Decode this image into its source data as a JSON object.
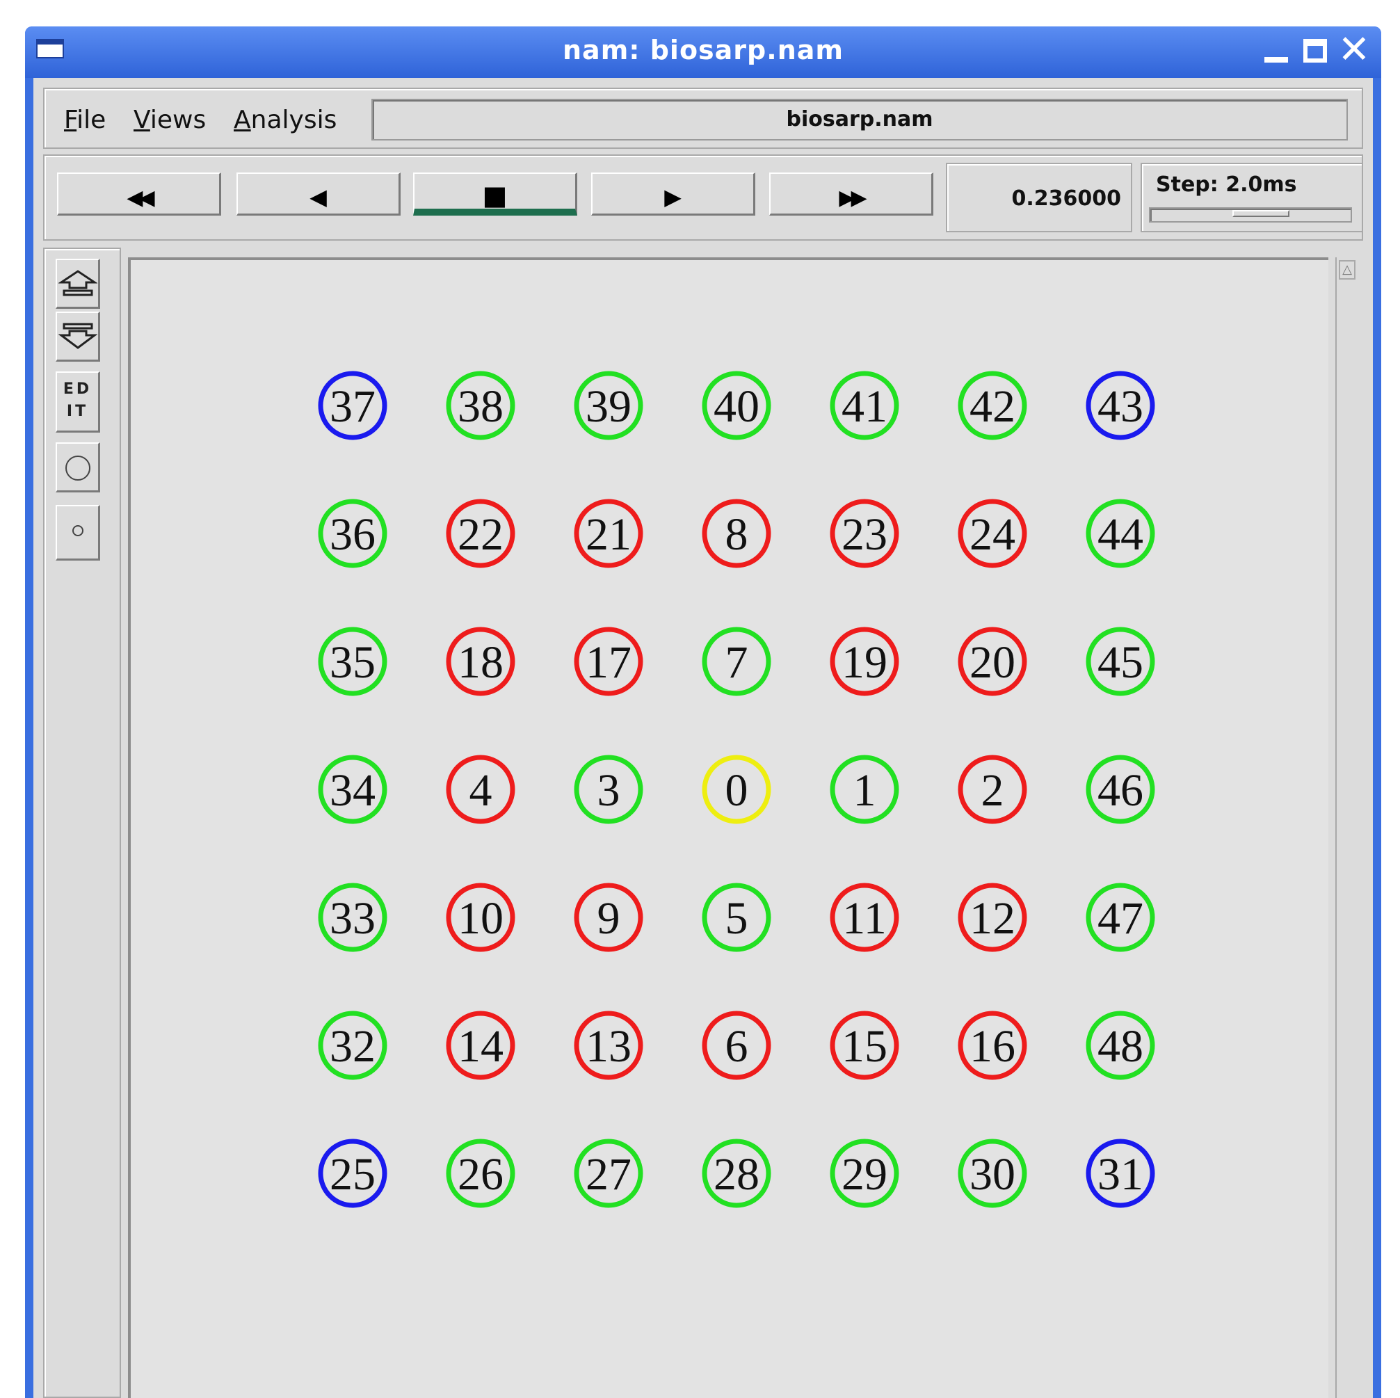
{
  "window": {
    "title": "nam: biosarp.nam",
    "close_glyph": "✕"
  },
  "menu": {
    "items": [
      {
        "label_first": "F",
        "label_rest": "ile"
      },
      {
        "label_first": "V",
        "label_rest": "iews"
      },
      {
        "label_first": "A",
        "label_rest": "nalysis"
      }
    ],
    "filename": "biosarp.nam"
  },
  "toolbar": {
    "buttons": [
      {
        "glyph": "◀◀",
        "icon": "rewind-icon"
      },
      {
        "glyph": "◀",
        "icon": "step-back-icon"
      },
      {
        "glyph": "■",
        "icon": "stop-icon"
      },
      {
        "glyph": "▶",
        "icon": "play-icon"
      },
      {
        "glyph": "▶▶",
        "icon": "fast-forward-icon"
      }
    ],
    "time": "0.236000",
    "step_label": "Step: 2.0ms"
  },
  "side_tools": {
    "edit_label_1": "ED",
    "edit_label_2": "IT"
  },
  "colors": {
    "blue": "#1a1aee",
    "green": "#22e022",
    "red": "#ee1c1c",
    "yellow": "#eeee10"
  },
  "nodes": {
    "rows": [
      [
        {
          "id": "37",
          "c": "blue"
        },
        {
          "id": "38",
          "c": "green"
        },
        {
          "id": "39",
          "c": "green"
        },
        {
          "id": "40",
          "c": "green"
        },
        {
          "id": "41",
          "c": "green"
        },
        {
          "id": "42",
          "c": "green"
        },
        {
          "id": "43",
          "c": "blue"
        }
      ],
      [
        {
          "id": "36",
          "c": "green"
        },
        {
          "id": "22",
          "c": "red"
        },
        {
          "id": "21",
          "c": "red"
        },
        {
          "id": "8",
          "c": "red"
        },
        {
          "id": "23",
          "c": "red"
        },
        {
          "id": "24",
          "c": "red"
        },
        {
          "id": "44",
          "c": "green"
        }
      ],
      [
        {
          "id": "35",
          "c": "green"
        },
        {
          "id": "18",
          "c": "red"
        },
        {
          "id": "17",
          "c": "red"
        },
        {
          "id": "7",
          "c": "green"
        },
        {
          "id": "19",
          "c": "red"
        },
        {
          "id": "20",
          "c": "red"
        },
        {
          "id": "45",
          "c": "green"
        }
      ],
      [
        {
          "id": "34",
          "c": "green"
        },
        {
          "id": "4",
          "c": "red"
        },
        {
          "id": "3",
          "c": "green"
        },
        {
          "id": "0",
          "c": "yellow"
        },
        {
          "id": "1",
          "c": "green"
        },
        {
          "id": "2",
          "c": "red"
        },
        {
          "id": "46",
          "c": "green"
        }
      ],
      [
        {
          "id": "33",
          "c": "green"
        },
        {
          "id": "10",
          "c": "red"
        },
        {
          "id": "9",
          "c": "red"
        },
        {
          "id": "5",
          "c": "green"
        },
        {
          "id": "11",
          "c": "red"
        },
        {
          "id": "12",
          "c": "red"
        },
        {
          "id": "47",
          "c": "green"
        }
      ],
      [
        {
          "id": "32",
          "c": "green"
        },
        {
          "id": "14",
          "c": "red"
        },
        {
          "id": "13",
          "c": "red"
        },
        {
          "id": "6",
          "c": "red"
        },
        {
          "id": "15",
          "c": "red"
        },
        {
          "id": "16",
          "c": "red"
        },
        {
          "id": "48",
          "c": "green"
        }
      ],
      [
        {
          "id": "25",
          "c": "blue"
        },
        {
          "id": "26",
          "c": "green"
        },
        {
          "id": "27",
          "c": "green"
        },
        {
          "id": "28",
          "c": "green"
        },
        {
          "id": "29",
          "c": "green"
        },
        {
          "id": "30",
          "c": "green"
        },
        {
          "id": "31",
          "c": "blue"
        }
      ]
    ]
  }
}
